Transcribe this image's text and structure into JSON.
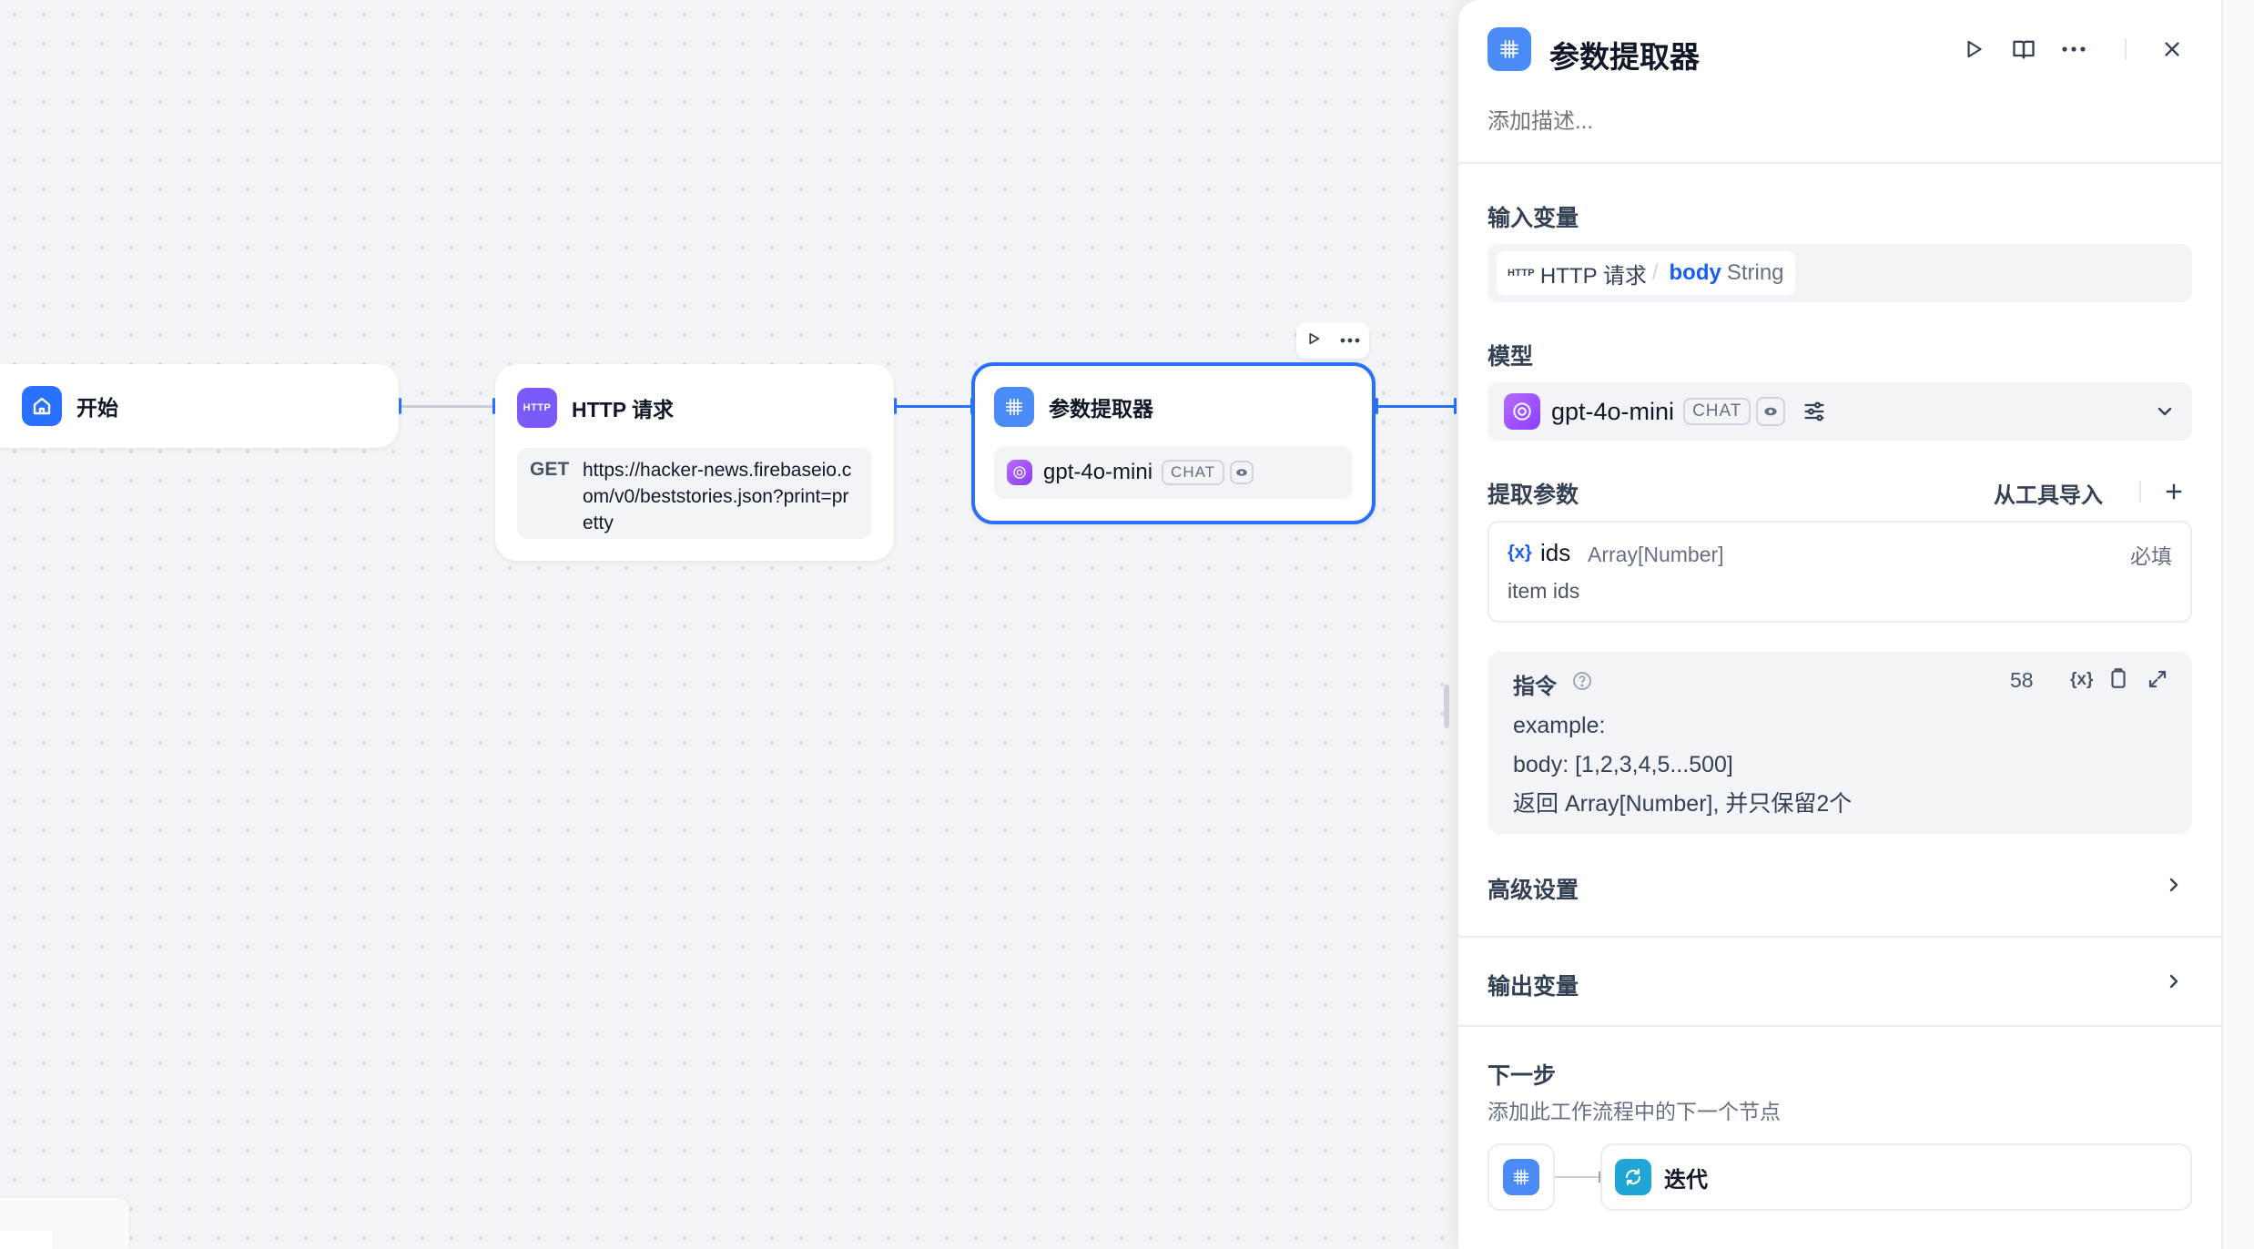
{
  "canvas": {
    "start_node": {
      "title": "开始"
    },
    "http_node": {
      "title": "HTTP 请求",
      "method": "GET",
      "url": "https://hacker-news.firebaseio.com/v0/beststories.json?print=pretty",
      "icon_text": "HTTP"
    },
    "param_node": {
      "title": "参数提取器",
      "model": "gpt-4o-mini",
      "model_badge": "CHAT"
    }
  },
  "panel": {
    "title": "参数提取器",
    "description_placeholder": "添加描述...",
    "input_vars": {
      "title": "输入变量",
      "source": "HTTP 请求",
      "source_icon_text": "HTTP",
      "separator": "/",
      "var_name": "body",
      "var_type": "String"
    },
    "model": {
      "title": "模型",
      "name": "gpt-4o-mini",
      "badge": "CHAT"
    },
    "extract_params": {
      "title": "提取参数",
      "import_label": "从工具导入",
      "param": {
        "icon": "{x}",
        "name": "ids",
        "type": "Array[Number]",
        "required": "必填",
        "description": "item ids"
      }
    },
    "instruction": {
      "title": "指令",
      "count": "58",
      "var_icon": "{x}",
      "lines": [
        "example:",
        "body: [1,2,3,4,5...500]",
        "返回 Array[Number], 并只保留2个"
      ]
    },
    "advanced": {
      "title": "高级设置"
    },
    "output": {
      "title": "输出变量"
    },
    "next_step": {
      "title": "下一步",
      "description": "添加此工作流程中的下一个节点",
      "next_node": "迭代"
    }
  },
  "colors": {
    "accent": "#2970ff",
    "param_icon": "#4a8bf6",
    "http_icon": "#7a5af8",
    "model_icon": "#9b51e0",
    "iteration_icon": "#1fa5d6"
  }
}
